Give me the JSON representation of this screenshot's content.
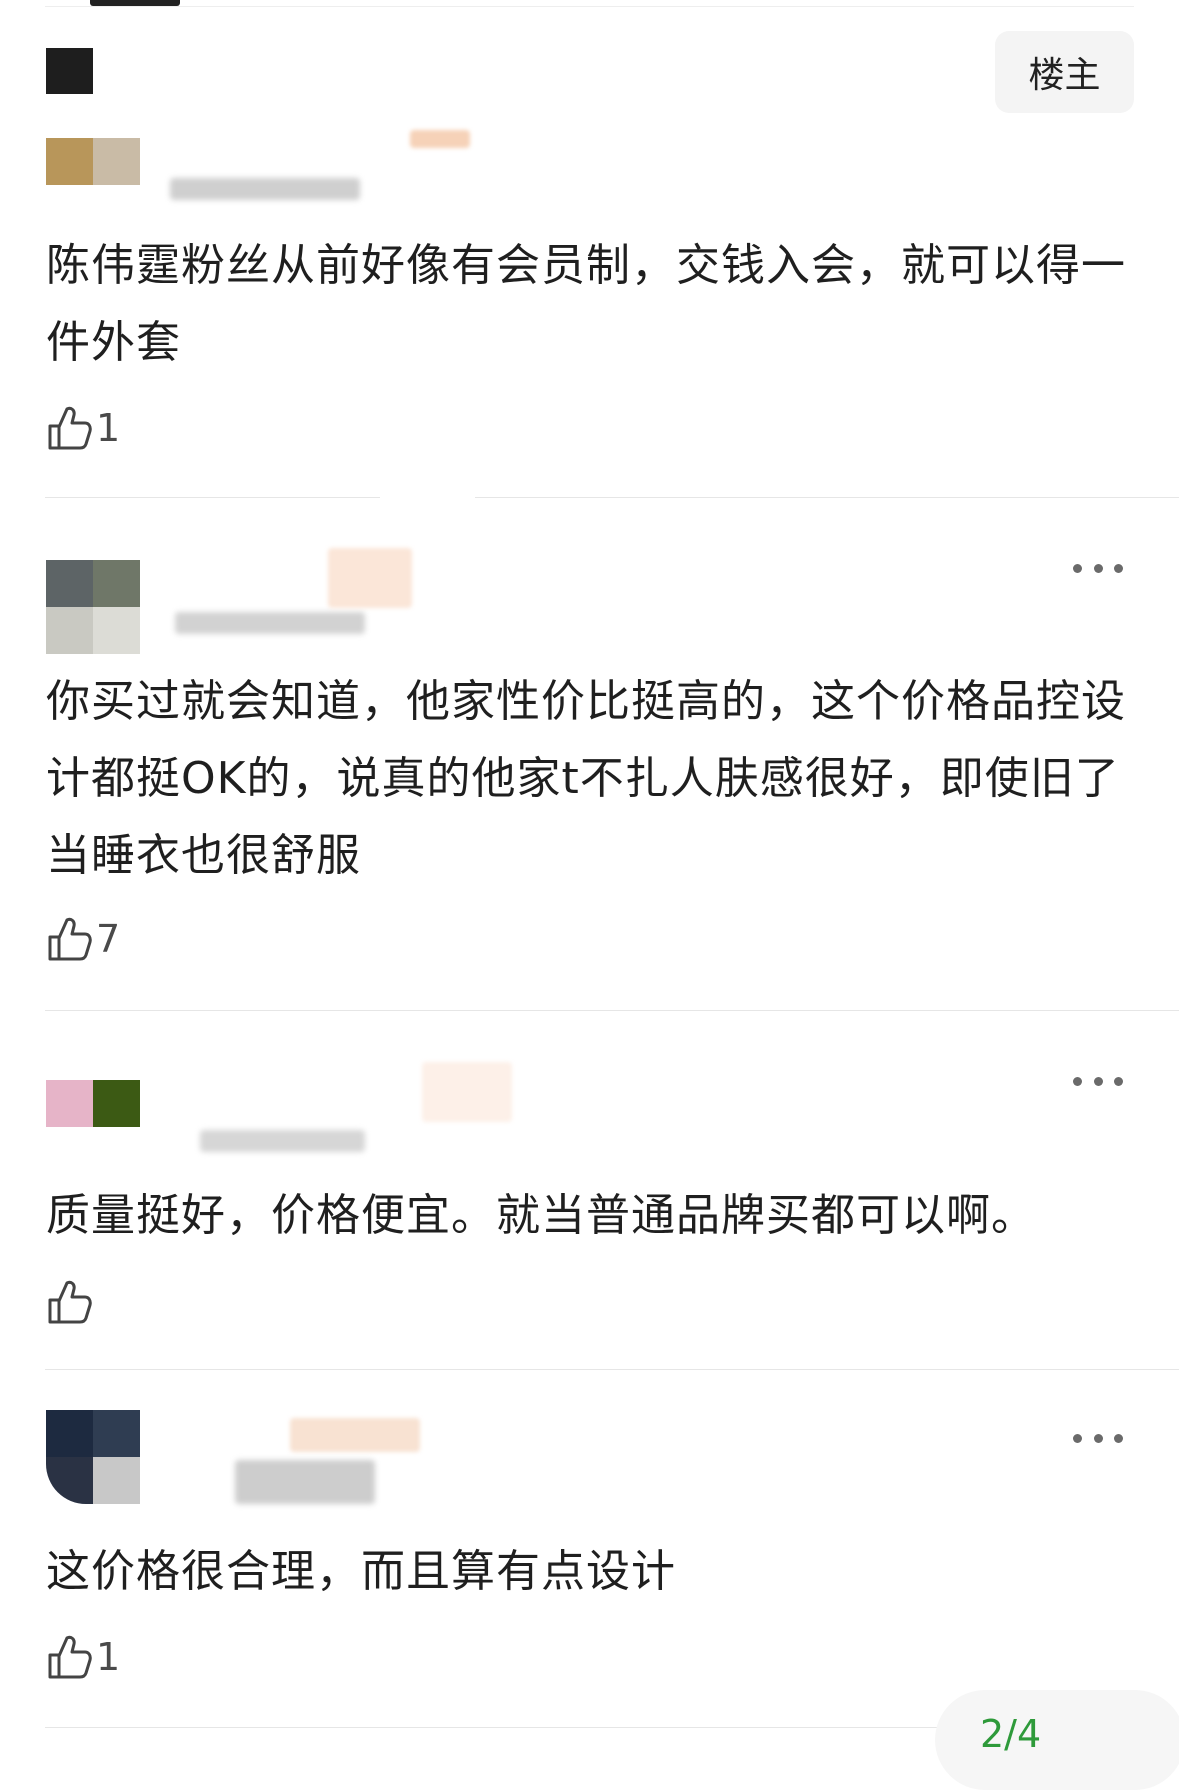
{
  "header": {
    "op_label": "楼主"
  },
  "comments": [
    {
      "text": "陈伟霆粉丝从前好像有会员制，交钱入会，就可以得一件外套",
      "likes": "1"
    },
    {
      "text": "你买过就会知道，他家性价比挺高的，这个价格品控设计都挺OK的，说真的他家t不扎人肤感很好，即使旧了当睡衣也很舒服",
      "likes": "7"
    },
    {
      "text": "质量挺好，价格便宜。就当普通品牌买都可以啊。",
      "likes": ""
    },
    {
      "text": "这价格很合理，而且算有点设计",
      "likes": "1"
    }
  ],
  "pagination": {
    "current": "2/4"
  },
  "colors": {
    "page_indicator": "#2e9a3a",
    "tag": "#f0a070"
  },
  "icons": {
    "like": "thumbs-up-icon",
    "more": "more-dots-icon"
  }
}
